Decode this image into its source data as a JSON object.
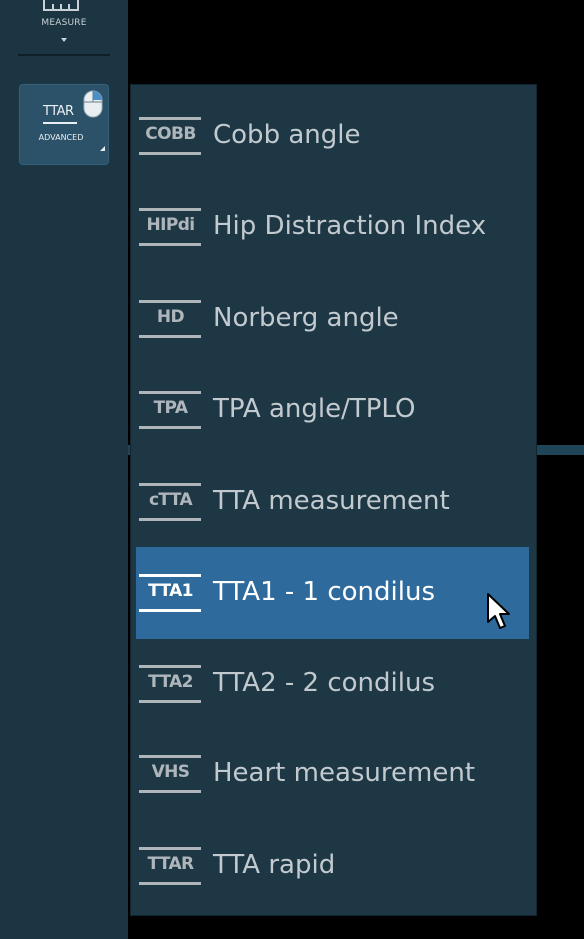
{
  "toolbar": {
    "measure_label": "MEASURE",
    "ttar_button": {
      "icon_text": "TTAR",
      "label": "ADVANCED"
    }
  },
  "menu": {
    "items": [
      {
        "badge": "COBB",
        "label": "Cobb angle",
        "selected": false
      },
      {
        "badge": "HIPdi",
        "label": "Hip Distraction Index",
        "selected": false
      },
      {
        "badge": "HD",
        "label": "Norberg angle",
        "selected": false
      },
      {
        "badge": "TPA",
        "label": "TPA angle/TPLO",
        "selected": false
      },
      {
        "badge": "cTTA",
        "label": "TTA measurement",
        "selected": false
      },
      {
        "badge": "TTA1",
        "label": "TTA1 - 1 condilus",
        "selected": true
      },
      {
        "badge": "TTA2",
        "label": "TTA2 - 2 condilus",
        "selected": false
      },
      {
        "badge": "VHS",
        "label": "Heart measurement",
        "selected": false
      },
      {
        "badge": "TTAR",
        "label": "TTA rapid",
        "selected": false
      }
    ]
  },
  "colors": {
    "toolbar_bg": "#1c3542",
    "menu_bg": "#1d3744",
    "selected_bg": "#2f6a9c",
    "text": "#c3cacf",
    "selected_text": "#ffffff"
  }
}
